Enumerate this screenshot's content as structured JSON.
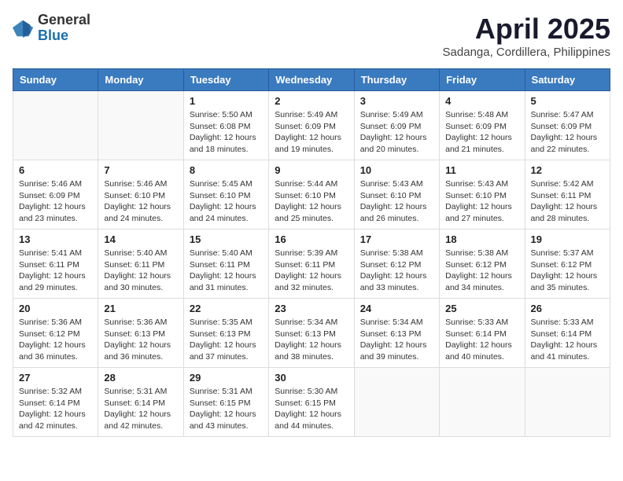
{
  "header": {
    "logo_general": "General",
    "logo_blue": "Blue",
    "month_title": "April 2025",
    "location": "Sadanga, Cordillera, Philippines"
  },
  "days_of_week": [
    "Sunday",
    "Monday",
    "Tuesday",
    "Wednesday",
    "Thursday",
    "Friday",
    "Saturday"
  ],
  "weeks": [
    [
      {
        "day": "",
        "info": ""
      },
      {
        "day": "",
        "info": ""
      },
      {
        "day": "1",
        "info": "Sunrise: 5:50 AM\nSunset: 6:08 PM\nDaylight: 12 hours and 18 minutes."
      },
      {
        "day": "2",
        "info": "Sunrise: 5:49 AM\nSunset: 6:09 PM\nDaylight: 12 hours and 19 minutes."
      },
      {
        "day": "3",
        "info": "Sunrise: 5:49 AM\nSunset: 6:09 PM\nDaylight: 12 hours and 20 minutes."
      },
      {
        "day": "4",
        "info": "Sunrise: 5:48 AM\nSunset: 6:09 PM\nDaylight: 12 hours and 21 minutes."
      },
      {
        "day": "5",
        "info": "Sunrise: 5:47 AM\nSunset: 6:09 PM\nDaylight: 12 hours and 22 minutes."
      }
    ],
    [
      {
        "day": "6",
        "info": "Sunrise: 5:46 AM\nSunset: 6:09 PM\nDaylight: 12 hours and 23 minutes."
      },
      {
        "day": "7",
        "info": "Sunrise: 5:46 AM\nSunset: 6:10 PM\nDaylight: 12 hours and 24 minutes."
      },
      {
        "day": "8",
        "info": "Sunrise: 5:45 AM\nSunset: 6:10 PM\nDaylight: 12 hours and 24 minutes."
      },
      {
        "day": "9",
        "info": "Sunrise: 5:44 AM\nSunset: 6:10 PM\nDaylight: 12 hours and 25 minutes."
      },
      {
        "day": "10",
        "info": "Sunrise: 5:43 AM\nSunset: 6:10 PM\nDaylight: 12 hours and 26 minutes."
      },
      {
        "day": "11",
        "info": "Sunrise: 5:43 AM\nSunset: 6:10 PM\nDaylight: 12 hours and 27 minutes."
      },
      {
        "day": "12",
        "info": "Sunrise: 5:42 AM\nSunset: 6:11 PM\nDaylight: 12 hours and 28 minutes."
      }
    ],
    [
      {
        "day": "13",
        "info": "Sunrise: 5:41 AM\nSunset: 6:11 PM\nDaylight: 12 hours and 29 minutes."
      },
      {
        "day": "14",
        "info": "Sunrise: 5:40 AM\nSunset: 6:11 PM\nDaylight: 12 hours and 30 minutes."
      },
      {
        "day": "15",
        "info": "Sunrise: 5:40 AM\nSunset: 6:11 PM\nDaylight: 12 hours and 31 minutes."
      },
      {
        "day": "16",
        "info": "Sunrise: 5:39 AM\nSunset: 6:11 PM\nDaylight: 12 hours and 32 minutes."
      },
      {
        "day": "17",
        "info": "Sunrise: 5:38 AM\nSunset: 6:12 PM\nDaylight: 12 hours and 33 minutes."
      },
      {
        "day": "18",
        "info": "Sunrise: 5:38 AM\nSunset: 6:12 PM\nDaylight: 12 hours and 34 minutes."
      },
      {
        "day": "19",
        "info": "Sunrise: 5:37 AM\nSunset: 6:12 PM\nDaylight: 12 hours and 35 minutes."
      }
    ],
    [
      {
        "day": "20",
        "info": "Sunrise: 5:36 AM\nSunset: 6:12 PM\nDaylight: 12 hours and 36 minutes."
      },
      {
        "day": "21",
        "info": "Sunrise: 5:36 AM\nSunset: 6:13 PM\nDaylight: 12 hours and 36 minutes."
      },
      {
        "day": "22",
        "info": "Sunrise: 5:35 AM\nSunset: 6:13 PM\nDaylight: 12 hours and 37 minutes."
      },
      {
        "day": "23",
        "info": "Sunrise: 5:34 AM\nSunset: 6:13 PM\nDaylight: 12 hours and 38 minutes."
      },
      {
        "day": "24",
        "info": "Sunrise: 5:34 AM\nSunset: 6:13 PM\nDaylight: 12 hours and 39 minutes."
      },
      {
        "day": "25",
        "info": "Sunrise: 5:33 AM\nSunset: 6:14 PM\nDaylight: 12 hours and 40 minutes."
      },
      {
        "day": "26",
        "info": "Sunrise: 5:33 AM\nSunset: 6:14 PM\nDaylight: 12 hours and 41 minutes."
      }
    ],
    [
      {
        "day": "27",
        "info": "Sunrise: 5:32 AM\nSunset: 6:14 PM\nDaylight: 12 hours and 42 minutes."
      },
      {
        "day": "28",
        "info": "Sunrise: 5:31 AM\nSunset: 6:14 PM\nDaylight: 12 hours and 42 minutes."
      },
      {
        "day": "29",
        "info": "Sunrise: 5:31 AM\nSunset: 6:15 PM\nDaylight: 12 hours and 43 minutes."
      },
      {
        "day": "30",
        "info": "Sunrise: 5:30 AM\nSunset: 6:15 PM\nDaylight: 12 hours and 44 minutes."
      },
      {
        "day": "",
        "info": ""
      },
      {
        "day": "",
        "info": ""
      },
      {
        "day": "",
        "info": ""
      }
    ]
  ]
}
